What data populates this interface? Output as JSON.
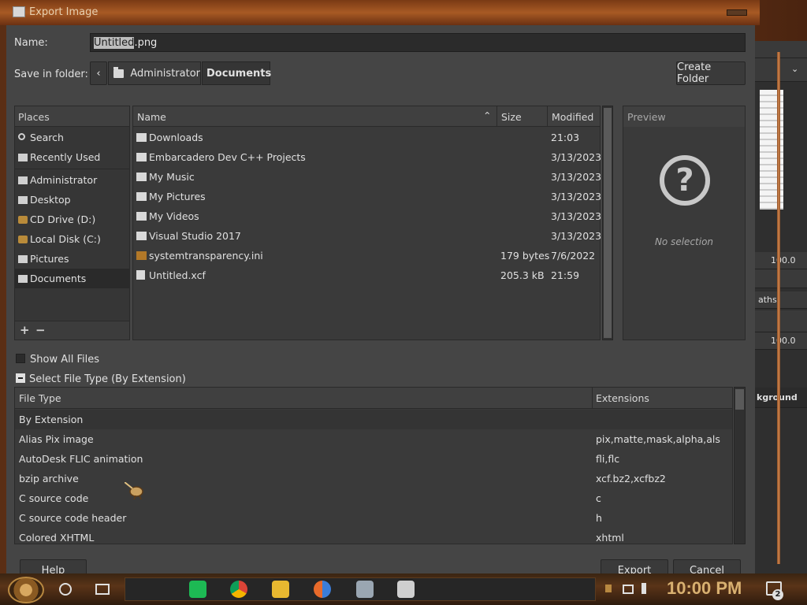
{
  "window": {
    "title": "Export Image"
  },
  "name_field": {
    "label": "Name:",
    "value_selected": "Untitled",
    "value_rest": ".png"
  },
  "folder": {
    "label": "Save in folder:",
    "crumbs": [
      "Administrator",
      "Documents"
    ],
    "create_folder": "Create Folder"
  },
  "places": {
    "header": "Places",
    "items": [
      {
        "label": "Search",
        "icon": "search-icon"
      },
      {
        "label": "Recently Used",
        "icon": "clock-icon"
      },
      {
        "label": "Administrator",
        "icon": "folder-icon"
      },
      {
        "label": "Desktop",
        "icon": "folder-icon"
      },
      {
        "label": "CD Drive (D:)",
        "icon": "disc-drive-icon"
      },
      {
        "label": "Local Disk (C:)",
        "icon": "disk-drive-icon"
      },
      {
        "label": "Pictures",
        "icon": "folder-icon"
      },
      {
        "label": "Documents",
        "icon": "folder-icon"
      }
    ],
    "add": "+",
    "remove": "−"
  },
  "files": {
    "columns": {
      "name": "Name",
      "size": "Size",
      "modified": "Modified"
    },
    "rows": [
      {
        "name": "Downloads",
        "size": "",
        "modified": "21:03",
        "kind": "folder"
      },
      {
        "name": "Embarcadero Dev C++ Projects",
        "size": "",
        "modified": "3/13/2023",
        "kind": "folder"
      },
      {
        "name": "My Music",
        "size": "",
        "modified": "3/13/2023",
        "kind": "folder"
      },
      {
        "name": "My Pictures",
        "size": "",
        "modified": "3/13/2023",
        "kind": "folder"
      },
      {
        "name": "My Videos",
        "size": "",
        "modified": "3/13/2023",
        "kind": "folder"
      },
      {
        "name": "Visual Studio 2017",
        "size": "",
        "modified": "3/13/2023",
        "kind": "folder"
      },
      {
        "name": "systemtransparency.ini",
        "size": "179 bytes",
        "modified": "7/6/2022",
        "kind": "ini"
      },
      {
        "name": "Untitled.xcf",
        "size": "205.3 kB",
        "modified": "21:59",
        "kind": "file"
      }
    ]
  },
  "preview": {
    "header": "Preview",
    "empty": "No selection",
    "icon": "question-icon"
  },
  "options": {
    "show_all_files": "Show All Files",
    "select_file_type": "Select File Type (By Extension)"
  },
  "filetypes": {
    "columns": {
      "type": "File Type",
      "ext": "Extensions"
    },
    "rows": [
      {
        "type": "By Extension",
        "ext": ""
      },
      {
        "type": "Alias Pix image",
        "ext": "pix,matte,mask,alpha,als"
      },
      {
        "type": "AutoDesk FLIC animation",
        "ext": "fli,flc"
      },
      {
        "type": "bzip archive",
        "ext": "xcf.bz2,xcfbz2"
      },
      {
        "type": "C source code",
        "ext": "c"
      },
      {
        "type": "C source code header",
        "ext": "h"
      },
      {
        "type": "Colored XHTML",
        "ext": "xhtml"
      }
    ]
  },
  "buttons": {
    "help": "Help",
    "export": "Export",
    "cancel": "Cancel"
  },
  "side_panel": {
    "value1": "100.0",
    "value2": "100.0",
    "paths_tab": "aths",
    "layer": "kground"
  },
  "taskbar": {
    "clock": "10:00 PM",
    "notifications": "2"
  },
  "colors": {
    "dialog_bg": "#454545",
    "frame": "#8a4a22",
    "clock": "#d8b070"
  }
}
